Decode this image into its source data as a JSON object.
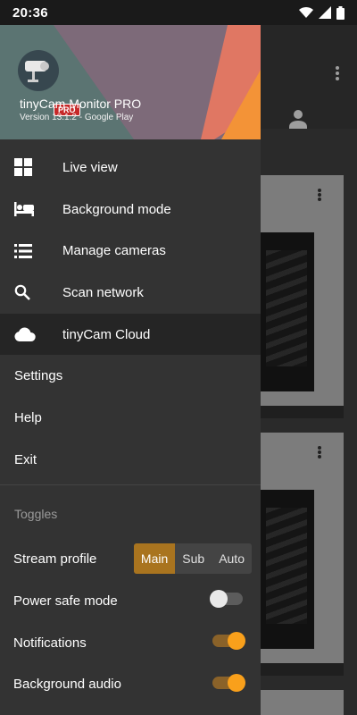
{
  "status_bar": {
    "time": "20:36"
  },
  "header": {
    "app_name": "tinyCam Monitor PRO",
    "version": "Version 13.1.2 - Google Play",
    "badge": "PRO"
  },
  "menu": {
    "items": [
      {
        "label": "Live view",
        "icon": "grid-icon"
      },
      {
        "label": "Background mode",
        "icon": "bed-icon"
      },
      {
        "label": "Manage cameras",
        "icon": "list-icon"
      },
      {
        "label": "Scan network",
        "icon": "search-icon"
      },
      {
        "label": "tinyCam Cloud",
        "icon": "cloud-icon",
        "selected": true
      }
    ],
    "plain_items": [
      "Settings",
      "Help",
      "Exit"
    ]
  },
  "toggles": {
    "title": "Toggles",
    "stream_profile": {
      "label": "Stream profile",
      "options": [
        "Main",
        "Sub",
        "Auto"
      ],
      "selected": "Main"
    },
    "power_safe": {
      "label": "Power safe mode",
      "on": false
    },
    "notifications": {
      "label": "Notifications",
      "on": true
    },
    "background_audio": {
      "label": "Background audio",
      "on": true
    }
  },
  "colors": {
    "accent": "#f9a01b",
    "segment_active": "#a9741f",
    "drawer_bg": "#333333"
  }
}
